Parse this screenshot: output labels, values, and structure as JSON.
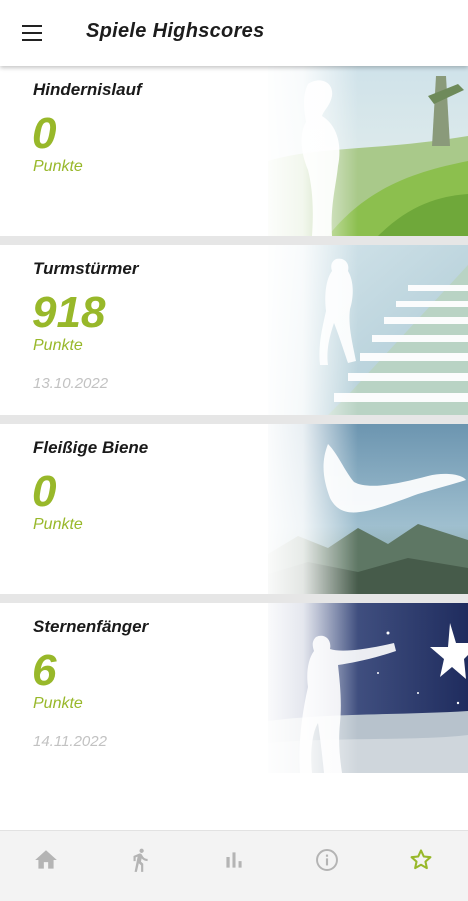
{
  "header": {
    "title": "Spiele Highscores",
    "menu_icon": "hamburger-menu-icon"
  },
  "games": [
    {
      "title": "Hindernislauf",
      "score": "0",
      "unit": "Punkte",
      "date": ""
    },
    {
      "title": "Turmstürmer",
      "score": "918",
      "unit": "Punkte",
      "date": "13.10.2022"
    },
    {
      "title": "Fleißige Biene",
      "score": "0",
      "unit": "Punkte",
      "date": ""
    },
    {
      "title": "Sternenfänger",
      "score": "6",
      "unit": "Punkte",
      "date": "14.11.2022"
    }
  ],
  "bottom_nav": {
    "items": [
      {
        "icon": "home-icon",
        "active": false
      },
      {
        "icon": "running-icon",
        "active": false
      },
      {
        "icon": "bar-chart-icon",
        "active": false
      },
      {
        "icon": "info-icon",
        "active": false
      },
      {
        "icon": "star-icon",
        "active": true
      }
    ]
  },
  "colors": {
    "accent": "#98b82a",
    "title_text": "#1a1a1a",
    "date_text": "#c2c2c2",
    "separator": "#e6e6e6",
    "nav_background": "#f3f3f3",
    "nav_inactive": "#b4b4b4"
  }
}
